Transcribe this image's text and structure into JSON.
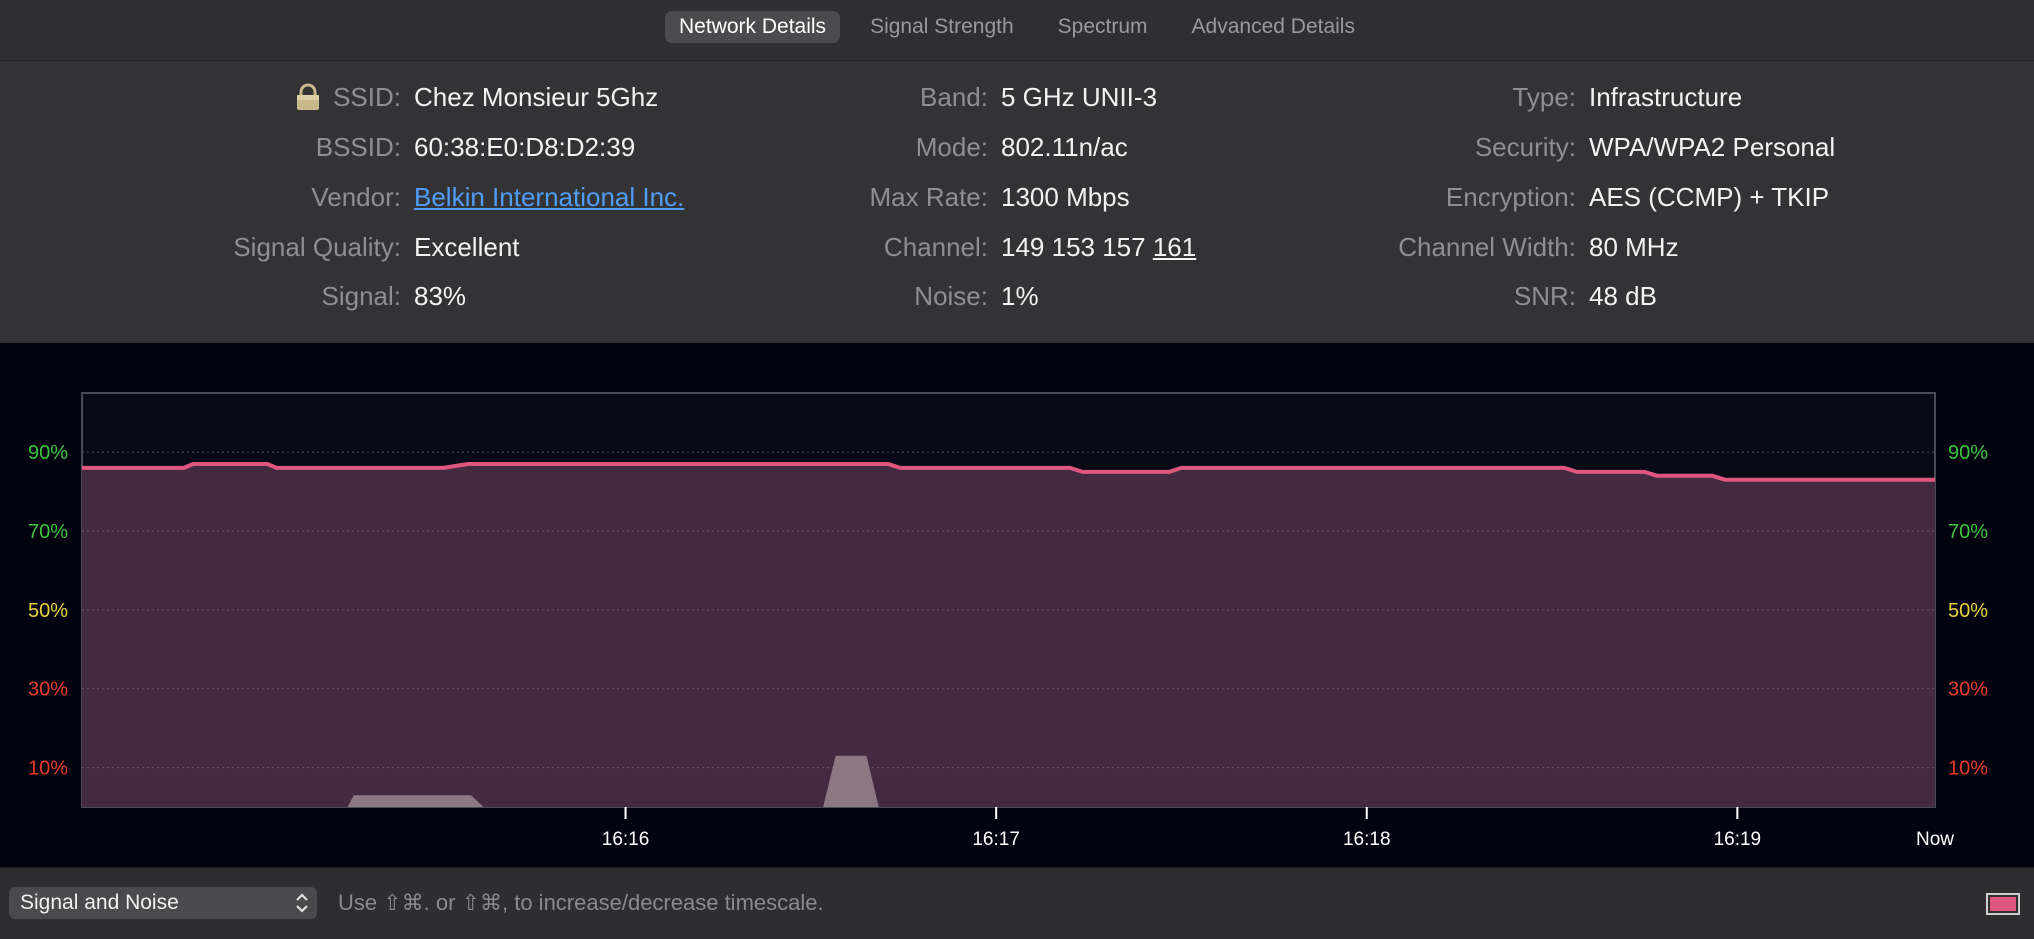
{
  "tabs": [
    {
      "label": "Network Details",
      "active": true
    },
    {
      "label": "Signal Strength",
      "active": false
    },
    {
      "label": "Spectrum",
      "active": false
    },
    {
      "label": "Advanced Details",
      "active": false
    }
  ],
  "details": {
    "ssid": {
      "label": "SSID:",
      "value": "Chez Monsieur 5Ghz"
    },
    "bssid": {
      "label": "BSSID:",
      "value": "60:38:E0:D8:D2:39"
    },
    "vendor": {
      "label": "Vendor:",
      "value": "Belkin International Inc."
    },
    "signal_quality": {
      "label": "Signal Quality:",
      "value": "Excellent"
    },
    "signal": {
      "label": "Signal:",
      "value": "83%"
    },
    "band": {
      "label": "Band:",
      "value": "5 GHz UNII-3"
    },
    "mode": {
      "label": "Mode:",
      "value": "802.11n/ac"
    },
    "max_rate": {
      "label": "Max Rate:",
      "value": "1300 Mbps"
    },
    "channel": {
      "label": "Channel:",
      "value_plain": "149 153 157 ",
      "value_primary": "161"
    },
    "noise": {
      "label": "Noise:",
      "value": "1%"
    },
    "type": {
      "label": "Type:",
      "value": "Infrastructure"
    },
    "security": {
      "label": "Security:",
      "value": "WPA/WPA2 Personal"
    },
    "encryption": {
      "label": "Encryption:",
      "value": "AES (CCMP) + TKIP"
    },
    "channel_width": {
      "label": "Channel Width:",
      "value": "80 MHz"
    },
    "snr": {
      "label": "SNR:",
      "value": "48 dB"
    }
  },
  "colors": {
    "vendor_link": "#4f9df7",
    "signal_line": "#e0577e",
    "signal_fill": "#442a40",
    "noise_fill": "#9a8590",
    "tick_green": "#3fc43f",
    "tick_yellow": "#e8d23a",
    "tick_red": "#e53b2c"
  },
  "chart_data": {
    "type": "area",
    "title": "",
    "xlabel": "",
    "ylabel": "",
    "ylim": [
      0,
      105
    ],
    "y_ticks": [
      "90%",
      "70%",
      "50%",
      "30%",
      "10%"
    ],
    "y_tick_values": [
      90,
      70,
      50,
      30,
      10
    ],
    "x_ticks": [
      "16:16",
      "16:17",
      "16:18",
      "16:19",
      "Now"
    ],
    "x_tick_seconds": [
      -212,
      -152,
      -92,
      -32,
      0
    ],
    "grid": true,
    "series": [
      {
        "key": "signal",
        "x": [
          -300,
          -283.5,
          -282,
          -270,
          -268.5,
          -255.5,
          -254,
          -241.5,
          -237.5,
          -171,
          -169.5,
          -167.5,
          -140,
          -138,
          -124,
          -122,
          -101,
          -99,
          -60,
          -58,
          -47,
          -45,
          -36,
          -34,
          0
        ],
        "values": [
          86,
          86,
          87,
          87,
          86,
          86,
          86,
          86,
          87,
          87,
          87,
          86,
          86,
          85,
          85,
          86,
          86,
          86,
          86,
          85,
          85,
          84,
          84,
          83,
          83
        ]
      },
      {
        "key": "noise",
        "x": [
          -300,
          -257,
          -256,
          -237,
          -235,
          -180,
          -178,
          -173,
          -171,
          0
        ],
        "values": [
          0,
          0,
          3,
          3,
          0,
          0,
          13,
          13,
          0,
          0
        ]
      }
    ]
  },
  "footer": {
    "mode_select": "Signal and Noise",
    "hint": "Use ⇧⌘. or ⇧⌘, to increase/decrease timescale."
  }
}
